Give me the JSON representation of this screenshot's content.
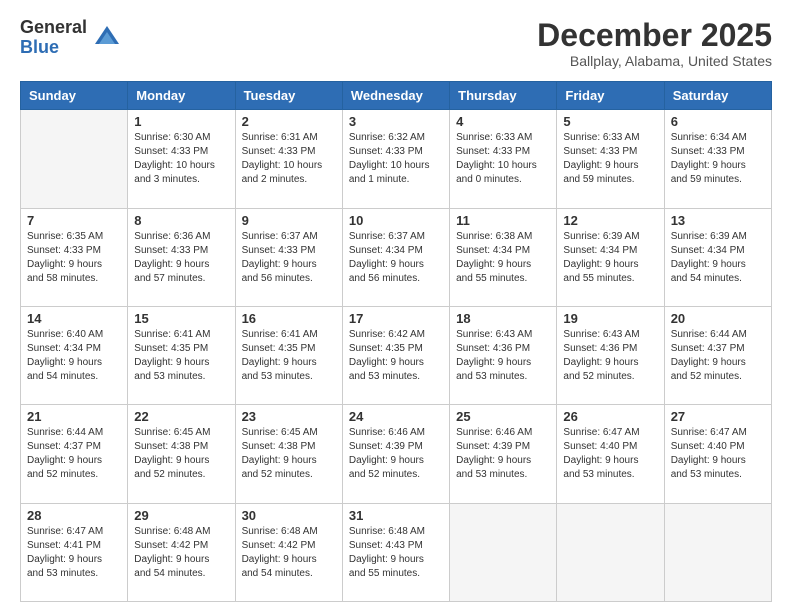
{
  "logo": {
    "general": "General",
    "blue": "Blue"
  },
  "header": {
    "title": "December 2025",
    "subtitle": "Ballplay, Alabama, United States"
  },
  "days_of_week": [
    "Sunday",
    "Monday",
    "Tuesday",
    "Wednesday",
    "Thursday",
    "Friday",
    "Saturday"
  ],
  "weeks": [
    [
      {
        "day": "",
        "info": ""
      },
      {
        "day": "1",
        "info": "Sunrise: 6:30 AM\nSunset: 4:33 PM\nDaylight: 10 hours\nand 3 minutes."
      },
      {
        "day": "2",
        "info": "Sunrise: 6:31 AM\nSunset: 4:33 PM\nDaylight: 10 hours\nand 2 minutes."
      },
      {
        "day": "3",
        "info": "Sunrise: 6:32 AM\nSunset: 4:33 PM\nDaylight: 10 hours\nand 1 minute."
      },
      {
        "day": "4",
        "info": "Sunrise: 6:33 AM\nSunset: 4:33 PM\nDaylight: 10 hours\nand 0 minutes."
      },
      {
        "day": "5",
        "info": "Sunrise: 6:33 AM\nSunset: 4:33 PM\nDaylight: 9 hours\nand 59 minutes."
      },
      {
        "day": "6",
        "info": "Sunrise: 6:34 AM\nSunset: 4:33 PM\nDaylight: 9 hours\nand 59 minutes."
      }
    ],
    [
      {
        "day": "7",
        "info": "Sunrise: 6:35 AM\nSunset: 4:33 PM\nDaylight: 9 hours\nand 58 minutes."
      },
      {
        "day": "8",
        "info": "Sunrise: 6:36 AM\nSunset: 4:33 PM\nDaylight: 9 hours\nand 57 minutes."
      },
      {
        "day": "9",
        "info": "Sunrise: 6:37 AM\nSunset: 4:33 PM\nDaylight: 9 hours\nand 56 minutes."
      },
      {
        "day": "10",
        "info": "Sunrise: 6:37 AM\nSunset: 4:34 PM\nDaylight: 9 hours\nand 56 minutes."
      },
      {
        "day": "11",
        "info": "Sunrise: 6:38 AM\nSunset: 4:34 PM\nDaylight: 9 hours\nand 55 minutes."
      },
      {
        "day": "12",
        "info": "Sunrise: 6:39 AM\nSunset: 4:34 PM\nDaylight: 9 hours\nand 55 minutes."
      },
      {
        "day": "13",
        "info": "Sunrise: 6:39 AM\nSunset: 4:34 PM\nDaylight: 9 hours\nand 54 minutes."
      }
    ],
    [
      {
        "day": "14",
        "info": "Sunrise: 6:40 AM\nSunset: 4:34 PM\nDaylight: 9 hours\nand 54 minutes."
      },
      {
        "day": "15",
        "info": "Sunrise: 6:41 AM\nSunset: 4:35 PM\nDaylight: 9 hours\nand 53 minutes."
      },
      {
        "day": "16",
        "info": "Sunrise: 6:41 AM\nSunset: 4:35 PM\nDaylight: 9 hours\nand 53 minutes."
      },
      {
        "day": "17",
        "info": "Sunrise: 6:42 AM\nSunset: 4:35 PM\nDaylight: 9 hours\nand 53 minutes."
      },
      {
        "day": "18",
        "info": "Sunrise: 6:43 AM\nSunset: 4:36 PM\nDaylight: 9 hours\nand 53 minutes."
      },
      {
        "day": "19",
        "info": "Sunrise: 6:43 AM\nSunset: 4:36 PM\nDaylight: 9 hours\nand 52 minutes."
      },
      {
        "day": "20",
        "info": "Sunrise: 6:44 AM\nSunset: 4:37 PM\nDaylight: 9 hours\nand 52 minutes."
      }
    ],
    [
      {
        "day": "21",
        "info": "Sunrise: 6:44 AM\nSunset: 4:37 PM\nDaylight: 9 hours\nand 52 minutes."
      },
      {
        "day": "22",
        "info": "Sunrise: 6:45 AM\nSunset: 4:38 PM\nDaylight: 9 hours\nand 52 minutes."
      },
      {
        "day": "23",
        "info": "Sunrise: 6:45 AM\nSunset: 4:38 PM\nDaylight: 9 hours\nand 52 minutes."
      },
      {
        "day": "24",
        "info": "Sunrise: 6:46 AM\nSunset: 4:39 PM\nDaylight: 9 hours\nand 52 minutes."
      },
      {
        "day": "25",
        "info": "Sunrise: 6:46 AM\nSunset: 4:39 PM\nDaylight: 9 hours\nand 53 minutes."
      },
      {
        "day": "26",
        "info": "Sunrise: 6:47 AM\nSunset: 4:40 PM\nDaylight: 9 hours\nand 53 minutes."
      },
      {
        "day": "27",
        "info": "Sunrise: 6:47 AM\nSunset: 4:40 PM\nDaylight: 9 hours\nand 53 minutes."
      }
    ],
    [
      {
        "day": "28",
        "info": "Sunrise: 6:47 AM\nSunset: 4:41 PM\nDaylight: 9 hours\nand 53 minutes."
      },
      {
        "day": "29",
        "info": "Sunrise: 6:48 AM\nSunset: 4:42 PM\nDaylight: 9 hours\nand 54 minutes."
      },
      {
        "day": "30",
        "info": "Sunrise: 6:48 AM\nSunset: 4:42 PM\nDaylight: 9 hours\nand 54 minutes."
      },
      {
        "day": "31",
        "info": "Sunrise: 6:48 AM\nSunset: 4:43 PM\nDaylight: 9 hours\nand 55 minutes."
      },
      {
        "day": "",
        "info": ""
      },
      {
        "day": "",
        "info": ""
      },
      {
        "day": "",
        "info": ""
      }
    ]
  ]
}
